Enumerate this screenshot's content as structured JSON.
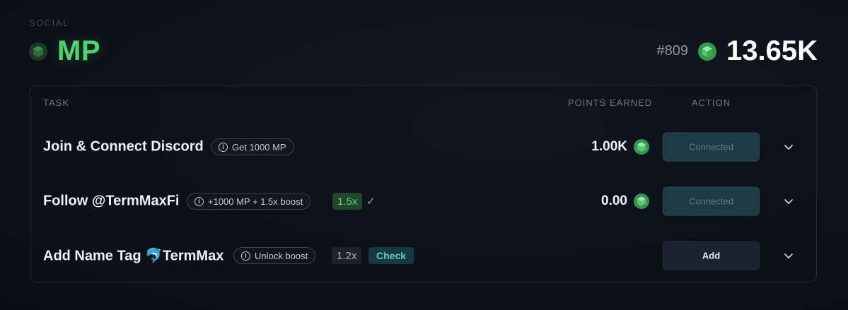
{
  "header": {
    "section_label": "SOCIAL",
    "title": "MP",
    "rank": "#809",
    "total_points": "13.65K"
  },
  "table": {
    "columns": {
      "task": "TASK",
      "points": "POINTS EARNED",
      "action": "ACTION"
    },
    "rows": [
      {
        "name": "Join & Connect Discord",
        "pill": "Get 1000 MP",
        "points": "1.00K",
        "action": "Connected"
      },
      {
        "name": "Follow @TermMaxFi",
        "pill": "+1000 MP + 1.5x boost",
        "boost": "1.5x",
        "boost_check": "✓",
        "points": "0.00",
        "action": "Connected"
      },
      {
        "name": "Add Name Tag 🐬TermMax",
        "pill": "Unlock boost",
        "boost": "1.2x",
        "check_label": "Check",
        "action": "Add"
      }
    ]
  },
  "colors": {
    "accent_green": "#4dd36f",
    "connected_bg": "#1e3b45",
    "check_cyan": "#5fc9d4"
  },
  "icons": {
    "gem": "gem-icon",
    "info": "info-icon",
    "expand": "chevron-down-icon",
    "check": "check-icon"
  }
}
